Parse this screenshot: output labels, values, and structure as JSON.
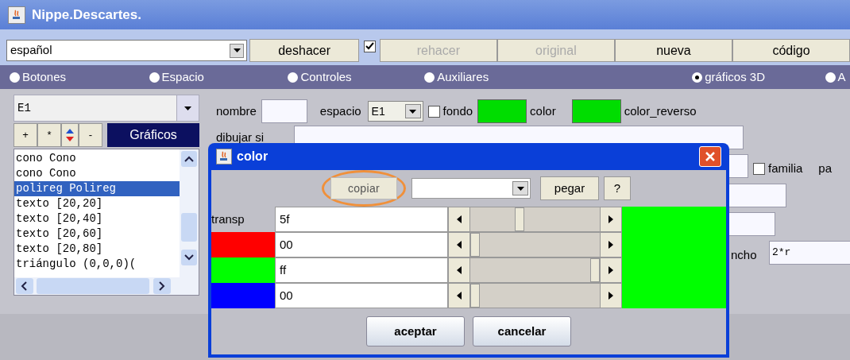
{
  "window": {
    "title": "Nippe.Descartes."
  },
  "toolbar": {
    "language": "español",
    "buttons": [
      {
        "label": "deshacer",
        "disabled": false
      },
      {
        "label": "rehacer",
        "disabled": true
      },
      {
        "label": "original",
        "disabled": true
      },
      {
        "label": "nueva",
        "disabled": false
      },
      {
        "label": "código",
        "disabled": false
      }
    ],
    "undo_checkbox": {
      "checked": true
    }
  },
  "radios": [
    {
      "label": "Botones",
      "selected": false
    },
    {
      "label": "Espacio",
      "selected": false
    },
    {
      "label": "Controles",
      "selected": false
    },
    {
      "label": "Auxiliares",
      "selected": false
    },
    {
      "label": "gráficos 3D",
      "selected": true
    },
    {
      "label": "A",
      "selected": false
    }
  ],
  "left_panel": {
    "space_select": "E1",
    "buttons": [
      "+",
      "*",
      "-"
    ],
    "section_label": "Gráficos",
    "items": [
      {
        "label": "cono Cono",
        "selected": false
      },
      {
        "label": "cono Cono",
        "selected": false
      },
      {
        "label": "polireg Polireg",
        "selected": true
      },
      {
        "label": "texto [20,20]",
        "selected": false
      },
      {
        "label": "texto [20,40]",
        "selected": false
      },
      {
        "label": "texto [20,60]",
        "selected": false
      },
      {
        "label": "texto [20,80]",
        "selected": false
      },
      {
        "label": "triángulo (0,0,0)(",
        "selected": false
      }
    ]
  },
  "form": {
    "nombre_label": "nombre",
    "espacio_label": "espacio",
    "espacio_value": "E1",
    "fondo": {
      "label": "fondo",
      "checked": false
    },
    "color_label": "color",
    "color_swatch": {
      "color": "#00dd00"
    },
    "color_reverso_label": "color_reverso",
    "reverso_swatch": {
      "color": "#00dd00"
    },
    "dibujar_label": "dibujar si",
    "familia": {
      "label": "familia",
      "checked": false
    },
    "pa_label": "pa",
    "ancho_label": "ncho",
    "ancho_value": "2*r"
  },
  "dialog": {
    "title": "color",
    "copy_button": "copiar",
    "paste_button": "pegar",
    "help_button": "?",
    "channels": [
      {
        "kind": "label",
        "label": "transp",
        "value": "5f",
        "level": 0.37
      },
      {
        "kind": "swatch",
        "color": "#ff0000",
        "value": "00",
        "level": 0
      },
      {
        "kind": "swatch",
        "color": "#00ff00",
        "value": "ff",
        "level": 1
      },
      {
        "kind": "swatch",
        "color": "#0000ff",
        "value": "00",
        "level": 0
      }
    ],
    "preview": {
      "color": "#00ff00"
    },
    "buttons": [
      "aceptar",
      "cancelar"
    ]
  }
}
